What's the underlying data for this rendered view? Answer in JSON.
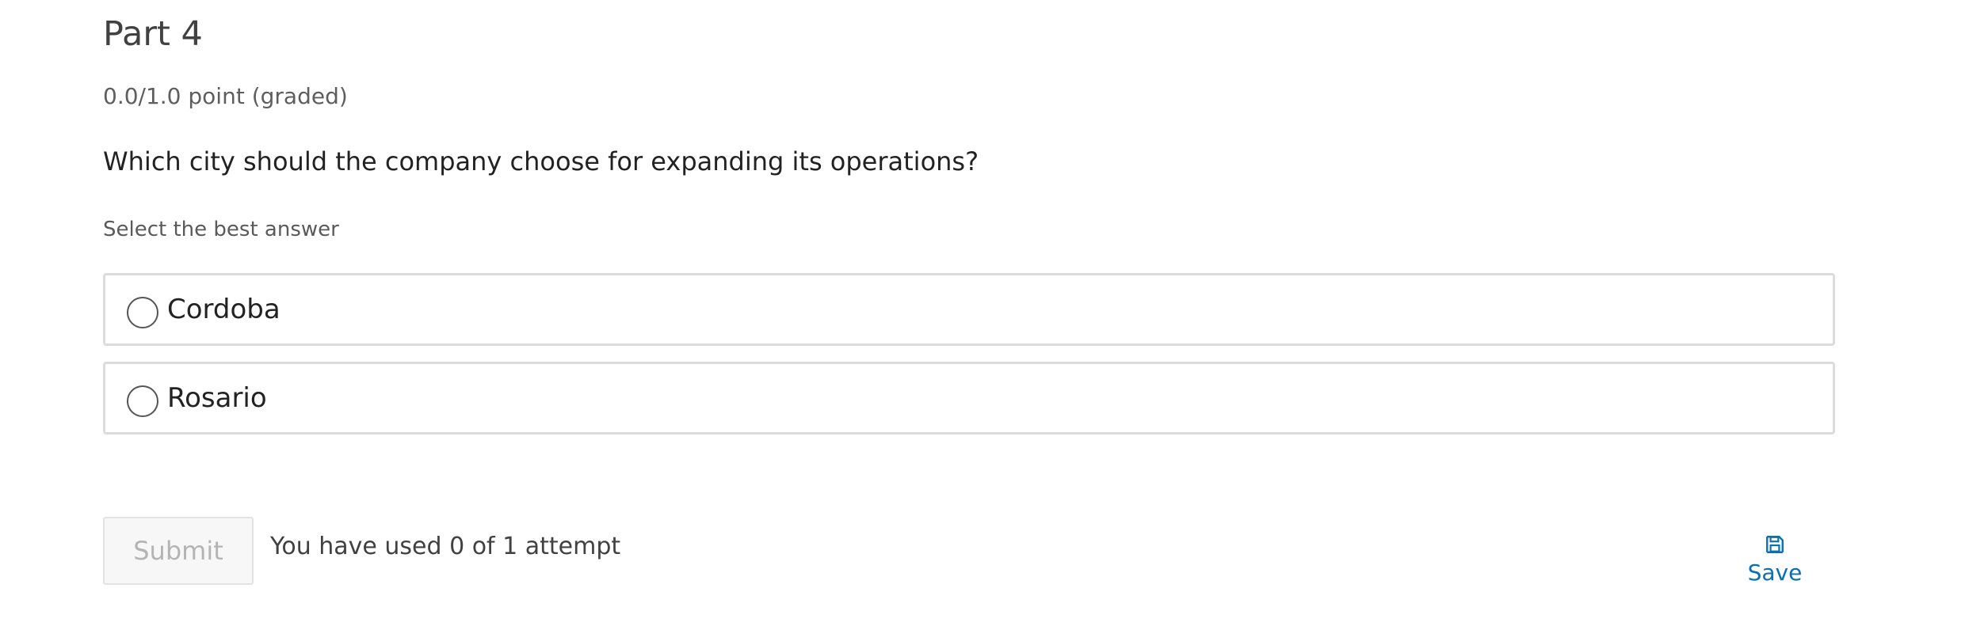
{
  "problem": {
    "title": "Part 4",
    "points": "0.0/1.0 point (graded)",
    "question": "Which city should the company choose for expanding its operations?",
    "instructions": "Select the best answer",
    "choices": [
      {
        "label": "Cordoba",
        "selected": false
      },
      {
        "label": "Rosario",
        "selected": false
      }
    ]
  },
  "actions": {
    "submit_label": "Submit",
    "attempts_text": "You have used 0 of 1 attempt",
    "save_label": "Save",
    "save_icon": "floppy-disk-icon"
  },
  "colors": {
    "accent": "#0b6fb3",
    "border": "#dcdcdc",
    "disabled_text": "#b4b4b4"
  }
}
